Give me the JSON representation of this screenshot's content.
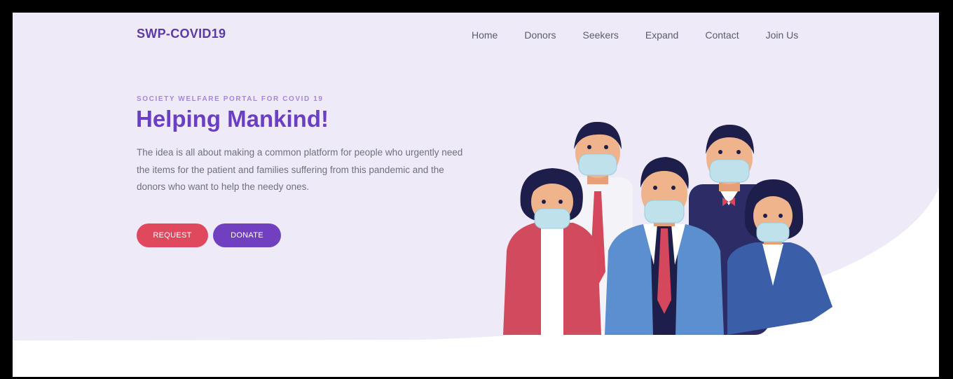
{
  "header": {
    "brand": "SWP-COVID19",
    "nav": [
      "Home",
      "Donors",
      "Seekers",
      "Expand",
      "Contact",
      "Join Us"
    ]
  },
  "hero": {
    "eyebrow": "SOCIETY WELFARE PORTAL FOR COVID 19",
    "title": "Helping Mankind!",
    "description": "The idea is all about making a common platform for people who urgently need the items for the patient and families suffering from this pandemic and the donors who want to help the needy ones.",
    "buttons": {
      "request": "REQUEST",
      "donate": "DONATE"
    }
  },
  "colors": {
    "hero_background": "#efeaf8",
    "brand_purple": "#6a3fc4",
    "request_red": "#e0485d",
    "donate_purple": "#7040c0"
  },
  "illustration": {
    "icon": "masked-people-group-icon"
  }
}
